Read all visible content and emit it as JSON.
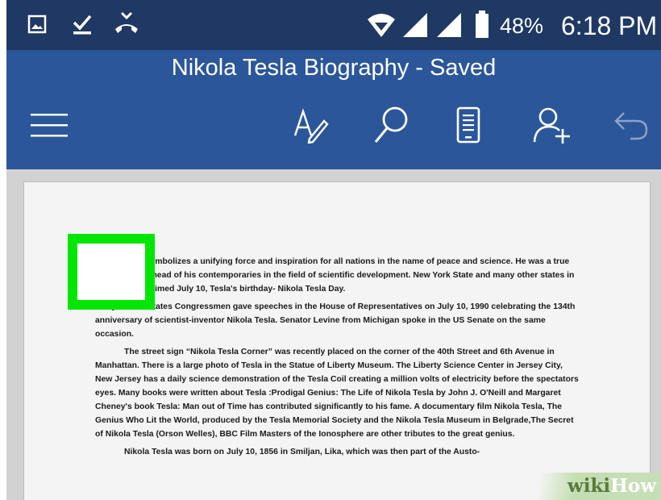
{
  "status_bar": {
    "battery": "48%",
    "time": "6:18 PM",
    "icons": [
      "image-notification-icon",
      "task-done-icon",
      "missed-call-icon",
      "wifi-icon",
      "signal-icon",
      "signal-icon-2",
      "battery-icon"
    ]
  },
  "app_bar": {
    "title": "Nikola Tesla Biography - Saved",
    "icons": [
      "menu-icon",
      "edit-text-icon",
      "search-icon",
      "mobile-view-icon",
      "share-icon",
      "undo-icon"
    ]
  },
  "document": {
    "paragraphs": [
      "Nikola Tesla symbolizes a unifying force and inspiration for all nations in the name of peace and science. He was a true visionary far ahead of his contemporaries in the field of scientific development. New York State and many other states in the USA proclaimed July 10, Tesla's birthday- Nikola Tesla Day.",
      "Many United States Congressmen gave speeches in the House of Representatives on July 10, 1990 celebrating the 134th anniversary of scientist-inventor Nikola Tesla. Senator Levine from Michigan spoke in the US Senate on the same occasion.",
      "The street sign “Nikola Tesla Corner” was recently placed on the corner of the 40th Street and 6th Avenue in Manhattan. There is a large photo of Tesla in the Statue of Liberty Museum. The Liberty Science Center in Jersey City, New Jersey has a daily science demonstration of the Tesla Coil creating a million volts of electricity before the spectators eyes. Many books were written about Tesla :Prodigal Genius: The Life of Nikola Tesla by John J. O'Neill  and Margaret Cheney's book Tesla: Man out of Time has contributed significantly to his fame. A documentary film Nikola Tesla, The Genius Who Lit the World, produced by the Tesla Memorial Society and the Nikola Tesla Museum in Belgrade,The Secret of Nikola Tesla (Orson Welles), BBC Film Masters of the Ionosphere are other tributes to the great genius.",
      "Nikola Tesla was born on July 10, 1856 in Smiljan, Lika, which was then part of  the Austo-"
    ]
  },
  "watermark": {
    "part1": "wiki",
    "part2": "How"
  },
  "colors": {
    "status_bar": "#1f3864",
    "app_bar": "#2b579a",
    "highlight": "#00e600"
  }
}
